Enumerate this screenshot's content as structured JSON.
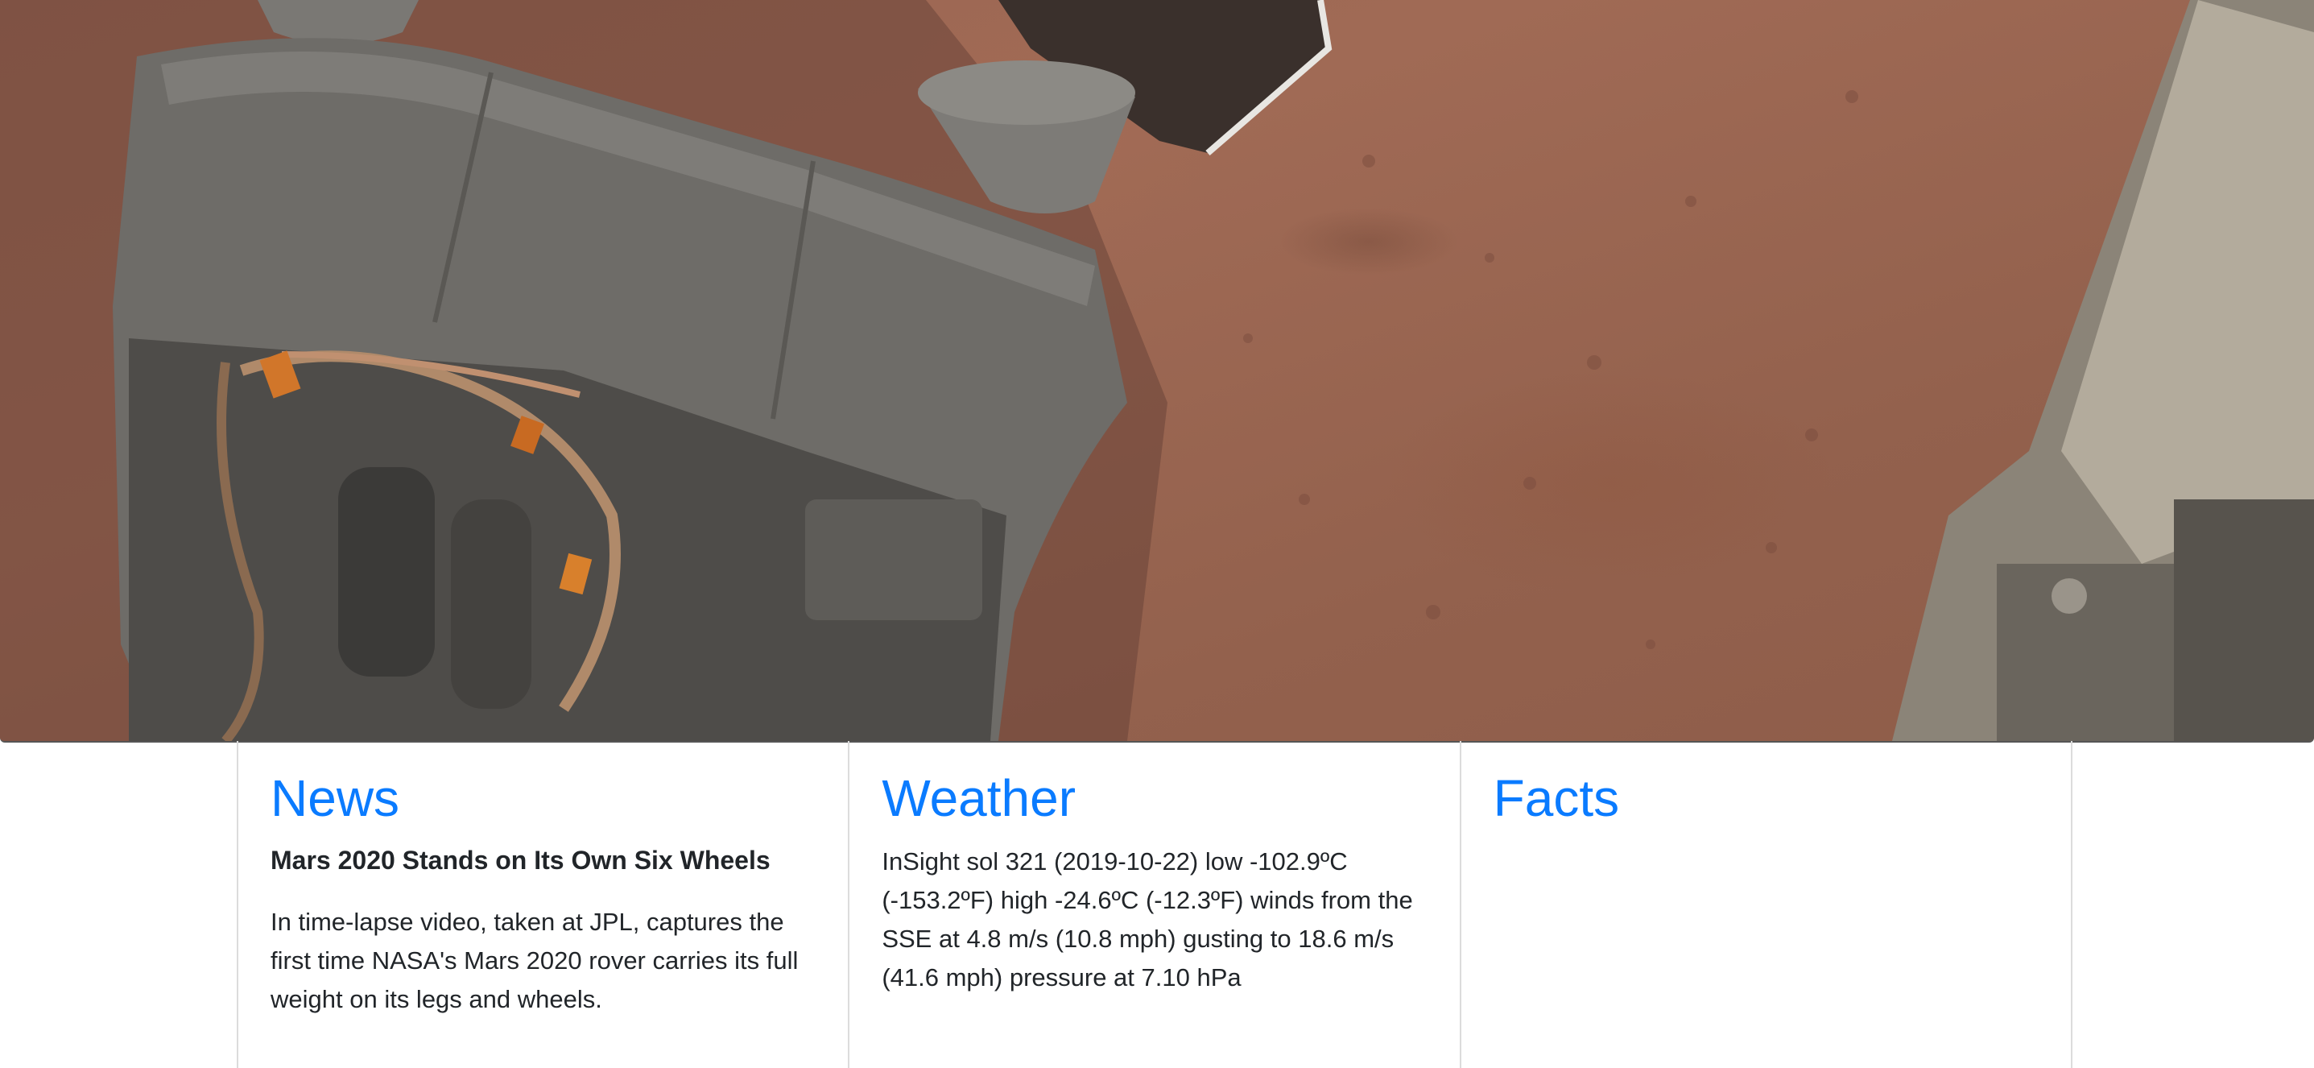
{
  "hero": {
    "image_description_icon": "mars-surface-image"
  },
  "cards": {
    "news": {
      "heading": "News",
      "headline": "Mars 2020 Stands on Its Own Six Wheels",
      "body": "In time-lapse video, taken at JPL, captures the first time NASA's Mars 2020 rover carries its full weight on its legs and wheels."
    },
    "weather": {
      "heading": "Weather",
      "body": "InSight sol 321 (2019-10-22) low -102.9ºC (-153.2ºF) high -24.6ºC (-12.3ºF) winds from the SSE at 4.8 m/s (10.8 mph) gusting to 18.6 m/s (41.6 mph) pressure at 7.10 hPa"
    },
    "facts": {
      "heading": "Facts"
    }
  },
  "colors": {
    "heading_blue": "#0a7bff",
    "text": "#212529",
    "mars_soil": "#9a6552"
  }
}
